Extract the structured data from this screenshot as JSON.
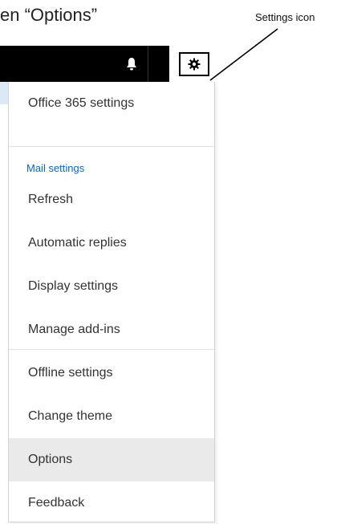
{
  "instruction_text": "en “Options”",
  "callout_label": "Settings icon",
  "header": {
    "bell_icon": "bell-icon",
    "settings_icon": "gear-icon"
  },
  "menu": {
    "office_settings": "Office 365 settings",
    "section_label": "Mail settings",
    "items": [
      {
        "label": "Refresh"
      },
      {
        "label": "Automatic replies"
      },
      {
        "label": "Display settings"
      },
      {
        "label": "Manage add-ins"
      },
      {
        "label": "Offline settings"
      },
      {
        "label": "Change theme"
      },
      {
        "label": "Options"
      },
      {
        "label": "Feedback"
      }
    ],
    "highlighted_item": "Options"
  },
  "colors": {
    "topbar": "#000000",
    "section_label": "#0a66c2",
    "highlight": "#eaeaea"
  }
}
